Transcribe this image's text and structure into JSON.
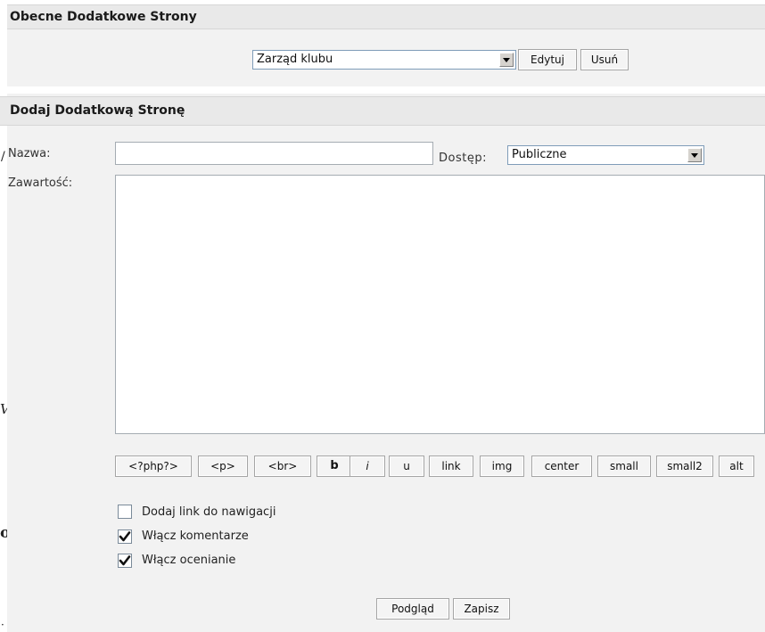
{
  "current_pages": {
    "header": "Obecne Dodatkowe Strony",
    "selected_page": "Zarząd klubu",
    "edit_label": "Edytuj",
    "delete_label": "Usuń"
  },
  "add_page": {
    "header": "Dodaj Dodatkową Stronę",
    "name_label": "Nazwa:",
    "name_value": "",
    "access_label": "Dostęp:",
    "access_value": "Publiczne",
    "content_label": "Zawartość:",
    "content_value": "",
    "toolbar": [
      "<?php?>",
      "<p>",
      "<br>",
      "b",
      "i",
      "u",
      "link",
      "img",
      "center",
      "small",
      "small2",
      "alt"
    ],
    "options": [
      {
        "label": "Dodaj link do nawigacji",
        "checked": false
      },
      {
        "label": "Włącz komentarze",
        "checked": true
      },
      {
        "label": "Włącz ocenianie",
        "checked": true
      }
    ],
    "preview_label": "Podgląd",
    "save_label": "Zapisz"
  },
  "edge_marks": [
    "/",
    "V",
    "o",
    "·"
  ]
}
